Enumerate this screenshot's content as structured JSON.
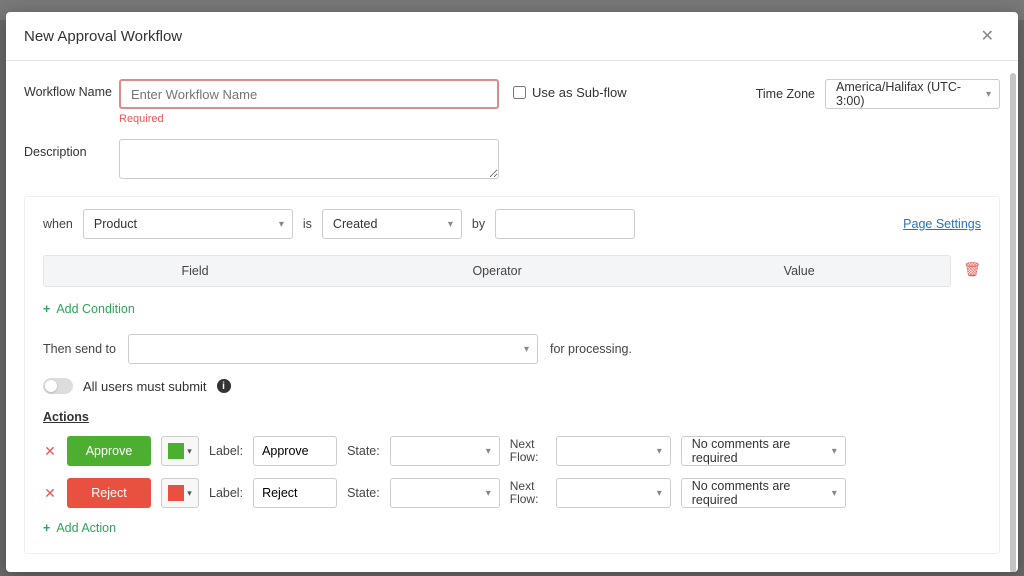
{
  "modal": {
    "title": "New Approval Workflow"
  },
  "form": {
    "workflow_name_label": "Workflow Name",
    "workflow_name_placeholder": "Enter Workflow Name",
    "workflow_name_required": "Required",
    "subflow_label": "Use as Sub-flow",
    "timezone_label": "Time Zone",
    "timezone_value": "America/Halifax (UTC-3:00)",
    "description_label": "Description"
  },
  "trigger": {
    "when": "when",
    "entity": "Product",
    "is": "is",
    "event": "Created",
    "by": "by",
    "page_settings": "Page Settings"
  },
  "conditions": {
    "headers": {
      "field": "Field",
      "operator": "Operator",
      "value": "Value"
    },
    "add": "Add Condition"
  },
  "send": {
    "prefix": "Then send to",
    "suffix": "for processing."
  },
  "toggle": {
    "label": "All users must submit"
  },
  "actions": {
    "heading": "Actions",
    "label_text": "Label:",
    "state_text": "State:",
    "nextflow_text": "Next Flow:",
    "add": "Add Action",
    "rows": [
      {
        "button": "Approve",
        "color": "green",
        "label_value": "Approve",
        "comments": "No comments are required"
      },
      {
        "button": "Reject",
        "color": "red",
        "label_value": "Reject",
        "comments": "No comments are required"
      }
    ]
  }
}
